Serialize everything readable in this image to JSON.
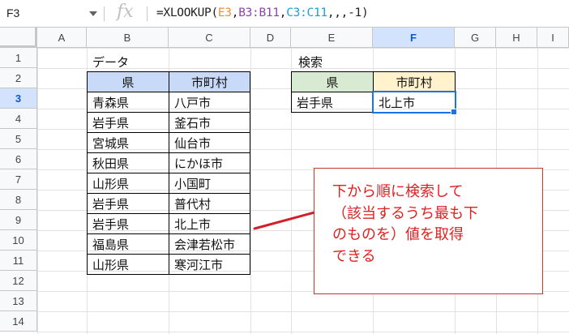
{
  "formula_bar": {
    "name_box": "F3",
    "fx_label": "fx",
    "formula": {
      "prefix": "=XLOOKUP(",
      "arg1": "E3",
      "c1": ",",
      "arg2": "B3:B11",
      "c2": ",",
      "arg3": "C3:C11",
      "suffix": ",,,-1)"
    }
  },
  "columns": [
    "A",
    "B",
    "C",
    "D",
    "E",
    "F",
    "G",
    "H",
    "I"
  ],
  "selected_column": "F",
  "rows": [
    "1",
    "2",
    "3",
    "4",
    "5",
    "6",
    "7",
    "8",
    "9",
    "10",
    "11",
    "12",
    "13",
    "14"
  ],
  "selected_row": "3",
  "data_table": {
    "title": "データ",
    "headers": [
      "県",
      "市町村"
    ],
    "rows": [
      [
        "青森県",
        "八戸市"
      ],
      [
        "岩手県",
        "釜石市"
      ],
      [
        "宮城県",
        "仙台市"
      ],
      [
        "秋田県",
        "にかほ市"
      ],
      [
        "山形県",
        "小国町"
      ],
      [
        "岩手県",
        "普代村"
      ],
      [
        "岩手県",
        "北上市"
      ],
      [
        "福島県",
        "会津若松市"
      ],
      [
        "山形県",
        "寒河江市"
      ]
    ]
  },
  "search_table": {
    "title": "検索",
    "headers": [
      "県",
      "市町村"
    ],
    "values": [
      "岩手県",
      "北上市"
    ]
  },
  "callout": {
    "lines": [
      "下から順に検索して",
      "（該当するうち最も下",
      "のものを）値を取得",
      "できる"
    ]
  },
  "colors": {
    "header_blue": "#c9daf8",
    "header_green": "#d9ead3",
    "header_yellow": "#fff2cc",
    "ref_e3": "#e69138",
    "ref_b": "#8e44ad",
    "ref_c": "#1e9bd7",
    "callout_text": "#e02020",
    "selection": "#1a73e8"
  }
}
